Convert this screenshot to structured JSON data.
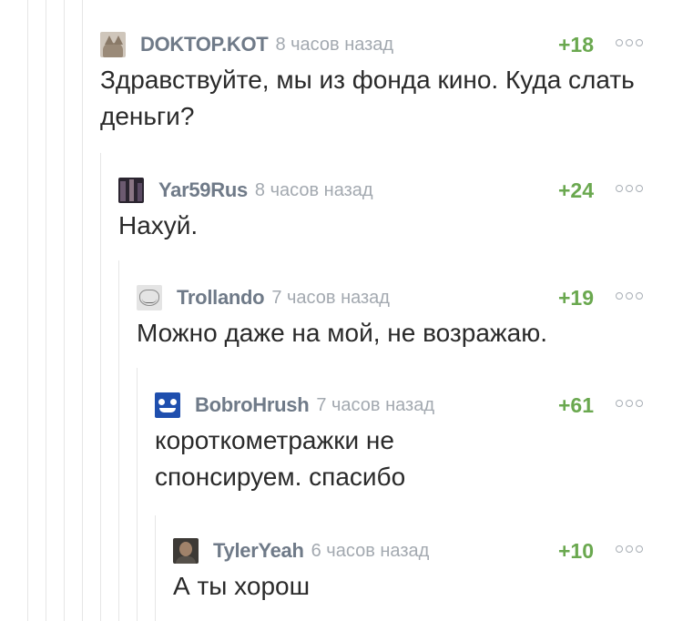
{
  "comments": [
    {
      "user": "DOKTOP.KOT",
      "time": "8 часов назад",
      "rating": "+18",
      "text": "Здравствуйте, мы из фонда кино. Куда слать деньги?",
      "avatar": "cat-avatar"
    },
    {
      "user": "Yar59Rus",
      "time": "8 часов назад",
      "rating": "+24",
      "text": "Нахуй.",
      "avatar": "dark-avatar"
    },
    {
      "user": "Trollando",
      "time": "7 часов назад",
      "rating": "+19",
      "text": "Можно даже на мой, не возражаю.",
      "avatar": "trollface-avatar"
    },
    {
      "user": "BobroHrush",
      "time": "7 часов назад",
      "rating": "+61",
      "text": "короткометражки не спонсируем. спасибо",
      "avatar": "blue-face-avatar"
    },
    {
      "user": "TylerYeah",
      "time": "6 часов назад",
      "rating": "+10",
      "text": "А ты хорош",
      "avatar": "photo-avatar"
    }
  ],
  "colors": {
    "rating": "#6aa84f",
    "username": "#6f7a88",
    "time": "#a3a9b0",
    "thread_line": "#e6e6e6"
  }
}
